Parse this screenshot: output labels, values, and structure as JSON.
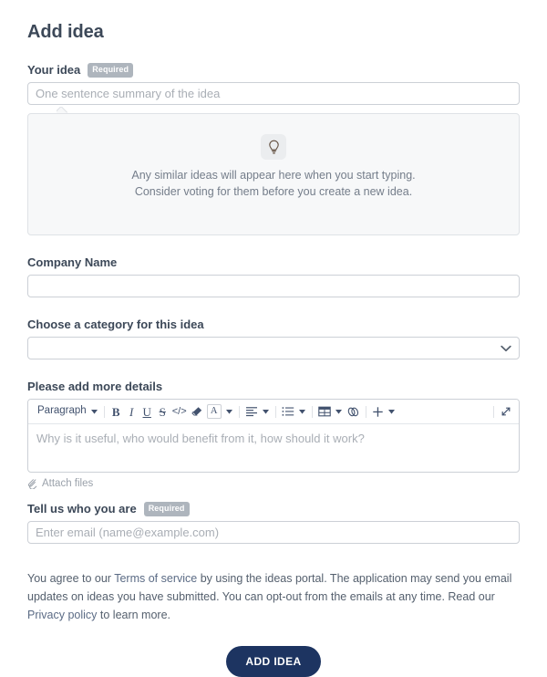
{
  "page": {
    "title": "Add idea"
  },
  "colors": {
    "text": "#3c4858",
    "muted": "#747d8a",
    "placeholder": "#a9aeb5",
    "border": "#ccd0d6",
    "panel_bg": "#f7f8f9",
    "badge_bg": "#aeb5bd",
    "link": "#5b6b85",
    "primary_button_bg": "#1d3461",
    "toolbar_icon": "#42526e"
  },
  "fields": {
    "idea": {
      "label": "Your idea",
      "required_badge": "Required",
      "placeholder": "One sentence summary of the idea",
      "value": ""
    },
    "similar": {
      "icon": "lightbulb-icon",
      "message": "Any similar ideas will appear here when you start typing. Consider voting for them before you create a new idea."
    },
    "company": {
      "label": "Company Name",
      "placeholder": "",
      "value": ""
    },
    "category": {
      "label": "Choose a category for this idea",
      "selected": "",
      "options": [
        ""
      ]
    },
    "details": {
      "label": "Please add more details",
      "placeholder": "Why is it useful, who would benefit from it, how should it work?",
      "value": "",
      "attach_label": "Attach files",
      "attach_icon": "paperclip-icon"
    },
    "email": {
      "label": "Tell us who you are",
      "required_badge": "Required",
      "placeholder": "Enter email (name@example.com)",
      "value": ""
    }
  },
  "editor_toolbar": {
    "block_format": "Paragraph",
    "items": [
      {
        "name": "block-format-dropdown",
        "label": "Paragraph",
        "type": "dropdown"
      },
      {
        "name": "bold-button",
        "label": "B",
        "type": "button"
      },
      {
        "name": "italic-button",
        "label": "I",
        "type": "button"
      },
      {
        "name": "underline-button",
        "label": "U",
        "type": "button"
      },
      {
        "name": "strikethrough-button",
        "label": "S",
        "type": "button"
      },
      {
        "name": "code-button",
        "label": "</>",
        "type": "button"
      },
      {
        "name": "clear-formatting-button",
        "label": "eraser-icon",
        "type": "button"
      },
      {
        "name": "text-color-button",
        "label": "A",
        "type": "dropdown"
      },
      {
        "name": "text-align-button",
        "label": "align-left-icon",
        "type": "dropdown"
      },
      {
        "name": "list-button",
        "label": "bullet-list-icon",
        "type": "dropdown"
      },
      {
        "name": "table-button",
        "label": "table-icon",
        "type": "dropdown"
      },
      {
        "name": "link-button",
        "label": "link-icon",
        "type": "button"
      },
      {
        "name": "insert-button",
        "label": "+",
        "type": "dropdown"
      },
      {
        "name": "fullscreen-button",
        "label": "expand-icon",
        "type": "button"
      }
    ]
  },
  "legal": {
    "part1": "You agree to our ",
    "link1": "Terms of service",
    "part2": " by using the ideas portal. The application may send you email updates on ideas you have submitted. You can opt-out from the emails at any time. Read our ",
    "link2": "Privacy policy",
    "part3": " to learn more."
  },
  "submit": {
    "label": "ADD IDEA"
  }
}
